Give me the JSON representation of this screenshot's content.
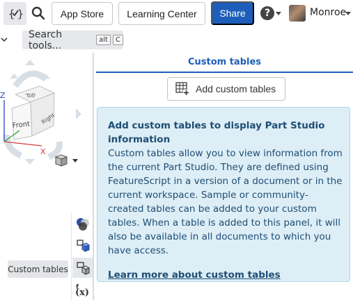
{
  "toolbar": {
    "app_store_label": "App Store",
    "learning_center_label": "Learning Center",
    "share_label": "Share",
    "help_label": "?",
    "user_name": "Monroe"
  },
  "search": {
    "label": "Search tools...",
    "shortcut_keys": [
      "alt",
      "C"
    ]
  },
  "viewcube": {
    "faces": [
      "Top",
      "Front",
      "Right"
    ],
    "axes": [
      "Z",
      "X"
    ]
  },
  "tooltip": {
    "text": "Custom tables"
  },
  "panel": {
    "title": "Custom tables",
    "add_button_label": "Add custom tables",
    "info_heading": "Add custom tables to display Part Studio information",
    "info_body": "Custom tables allow you to view information from the current Part Studio. They are defined using FeatureScript in a version of a document or in the current workspace. Sample or community-created tables can be added to your custom tables. When a table is added to this panel, it will also be available in all documents to which you have access.",
    "learn_more_link": "Learn more about custom tables"
  },
  "colors": {
    "accent": "#1e5ebb",
    "info_bg": "#ddeef6",
    "info_text": "#1e4d74"
  },
  "icons": [
    "featurescript-icon",
    "search-icon",
    "help-icon",
    "avatar",
    "chevron-down-icon",
    "appearance-icon",
    "configurations-icon",
    "custom-tables-icon",
    "variables-icon",
    "add-table-icon",
    "view-cube-icon"
  ]
}
